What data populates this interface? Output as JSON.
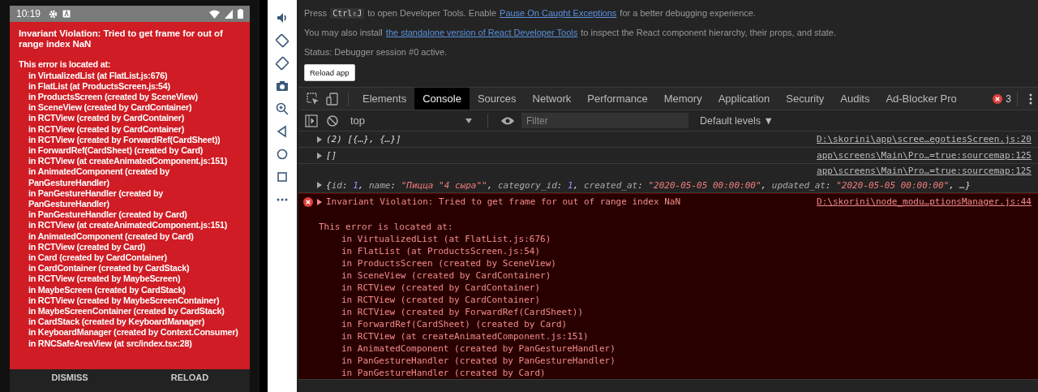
{
  "phone": {
    "status_bar": {
      "time": "10:19"
    },
    "error": {
      "title": "Invariant Violation: Tried to get frame for out of range index NaN",
      "lines": [
        {
          "kind": "header",
          "text": "This error is located at:"
        },
        {
          "kind": "frame",
          "text": "in VirtualizedList (at FlatList.js:676)"
        },
        {
          "kind": "frame",
          "text": "in FlatList (at ProductsScreen.js:54)"
        },
        {
          "kind": "frame",
          "text": "in ProductsScreen (created by SceneView)"
        },
        {
          "kind": "frame",
          "text": "in SceneView (created by CardContainer)"
        },
        {
          "kind": "frame",
          "text": "in RCTView (created by CardContainer)"
        },
        {
          "kind": "frame",
          "text": "in RCTView (created by CardContainer)"
        },
        {
          "kind": "frame",
          "text": "in RCTView (created by ForwardRef(CardSheet))"
        },
        {
          "kind": "frame",
          "text": "in ForwardRef(CardSheet) (created by Card)"
        },
        {
          "kind": "frame",
          "text": "in RCTView (at createAnimatedComponent.js:151)"
        },
        {
          "kind": "frame",
          "text": "in AnimatedComponent (created by PanGestureHandler)"
        },
        {
          "kind": "frame",
          "text": "in PanGestureHandler (created by PanGestureHandler)"
        },
        {
          "kind": "frame",
          "text": "in PanGestureHandler (created by Card)"
        },
        {
          "kind": "frame",
          "text": "in RCTView (at createAnimatedComponent.js:151)"
        },
        {
          "kind": "frame",
          "text": "in AnimatedComponent (created by Card)"
        },
        {
          "kind": "frame",
          "text": "in RCTView (created by Card)"
        },
        {
          "kind": "frame",
          "text": "in Card (created by CardContainer)"
        },
        {
          "kind": "frame",
          "text": "in CardContainer (created by CardStack)"
        },
        {
          "kind": "frame",
          "text": "in RCTView (created by MaybeScreen)"
        },
        {
          "kind": "frame",
          "text": "in MaybeScreen (created by CardStack)"
        },
        {
          "kind": "frame",
          "text": "in RCTView (created by MaybeScreenContainer)"
        },
        {
          "kind": "frame",
          "text": "in MaybeScreenContainer (created by CardStack)"
        },
        {
          "kind": "frame",
          "text": "in CardStack (created by KeyboardManager)"
        },
        {
          "kind": "frame",
          "text": "in KeyboardManager (created by Context.Consumer)"
        },
        {
          "kind": "frame",
          "text": "in RNCSafeAreaView (at src/index.tsx:28)"
        }
      ]
    },
    "buttons": [
      {
        "label": "DISMISS"
      },
      {
        "label": "RELOAD"
      }
    ]
  },
  "debugger": {
    "info": [
      [
        {
          "kind": "text",
          "text": "Press"
        },
        {
          "kind": "kbd",
          "text": "Ctrl⇧J"
        },
        {
          "kind": "text",
          "text": "to open Developer Tools. Enable"
        },
        {
          "kind": "link",
          "text": "Pause On Caught Exceptions"
        },
        {
          "kind": "text",
          "text": "for a better debugging experience."
        }
      ],
      [
        {
          "kind": "text",
          "text": "You may also install"
        },
        {
          "kind": "link",
          "text": "the standalone version of React Developer Tools"
        },
        {
          "kind": "text",
          "text": "to inspect the React component hierarchy, their props, and state."
        }
      ],
      [
        {
          "kind": "text",
          "text": "Status: Debugger session #0 active."
        }
      ]
    ],
    "reload_button": "Reload app"
  },
  "devtools": {
    "tabs": [
      {
        "label": "Elements",
        "selected": false
      },
      {
        "label": "Console",
        "selected": true
      },
      {
        "label": "Sources",
        "selected": false
      },
      {
        "label": "Network",
        "selected": false
      },
      {
        "label": "Performance",
        "selected": false
      },
      {
        "label": "Memory",
        "selected": false
      },
      {
        "label": "Application",
        "selected": false
      },
      {
        "label": "Security",
        "selected": false
      },
      {
        "label": "Audits",
        "selected": false
      },
      {
        "label": "Ad-Blocker Pro",
        "selected": false
      }
    ],
    "error_count": "3",
    "toolbar": {
      "context": "top",
      "filter_placeholder": "Filter",
      "levels": "Default levels ▼"
    },
    "console": [
      {
        "kind": "log",
        "source": "D:\\skorini\\app\\scree…egotiesScreen.js:20",
        "message": [
          {
            "kind": "plain",
            "text": "(2) [{…}, {…}]"
          }
        ]
      },
      {
        "kind": "log",
        "source": "app\\screens\\Main\\Pro…=true:sourcemap:125",
        "message": [
          {
            "kind": "plain",
            "text": "[]"
          }
        ]
      },
      {
        "kind": "object",
        "source": "app\\screens\\Main\\Pro…=true:sourcemap:125",
        "message": [
          {
            "kind": "plain",
            "text": "{"
          },
          {
            "kind": "key",
            "text": "id"
          },
          {
            "kind": "plain",
            "text": ": "
          },
          {
            "kind": "number",
            "text": "1"
          },
          {
            "kind": "plain",
            "text": ", "
          },
          {
            "kind": "key",
            "text": "name"
          },
          {
            "kind": "plain",
            "text": ": "
          },
          {
            "kind": "string",
            "text": "\"Пицца \"4 сыра\"\""
          },
          {
            "kind": "plain",
            "text": ", "
          },
          {
            "kind": "key",
            "text": "category_id"
          },
          {
            "kind": "plain",
            "text": ": "
          },
          {
            "kind": "number",
            "text": "1"
          },
          {
            "kind": "plain",
            "text": ", "
          },
          {
            "kind": "key",
            "text": "created_at"
          },
          {
            "kind": "plain",
            "text": ": "
          },
          {
            "kind": "string",
            "text": "\"2020-05-05 00:00:00\""
          },
          {
            "kind": "plain",
            "text": ", "
          },
          {
            "kind": "key",
            "text": "updated_at"
          },
          {
            "kind": "plain",
            "text": ": "
          },
          {
            "kind": "string",
            "text": "\"2020-05-05 00:00:00\""
          },
          {
            "kind": "plain",
            "text": ", …}"
          }
        ]
      },
      {
        "kind": "error",
        "source": "D:\\skorini\\node_modu…ptionsManager.js:44",
        "message": [
          {
            "kind": "plain",
            "text": "Invariant Violation: Tried to get frame for out of range index NaN"
          }
        ],
        "stack": [
          {
            "kind": "header",
            "text": "This error is located at:"
          },
          {
            "kind": "frame",
            "text": "in VirtualizedList (at FlatList.js:676)"
          },
          {
            "kind": "frame",
            "text": "in FlatList (at ProductsScreen.js:54)"
          },
          {
            "kind": "frame",
            "text": "in ProductsScreen (created by SceneView)"
          },
          {
            "kind": "frame",
            "text": "in SceneView (created by CardContainer)"
          },
          {
            "kind": "frame",
            "text": "in RCTView (created by CardContainer)"
          },
          {
            "kind": "frame",
            "text": "in RCTView (created by CardContainer)"
          },
          {
            "kind": "frame",
            "text": "in RCTView (created by ForwardRef(CardSheet))"
          },
          {
            "kind": "frame",
            "text": "in ForwardRef(CardSheet) (created by Card)"
          },
          {
            "kind": "frame",
            "text": "in RCTView (at createAnimatedComponent.js:151)"
          },
          {
            "kind": "frame",
            "text": "in AnimatedComponent (created by PanGestureHandler)"
          },
          {
            "kind": "frame",
            "text": "in PanGestureHandler (created by PanGestureHandler)"
          },
          {
            "kind": "frame",
            "text": "in PanGestureHandler (created by Card)"
          }
        ]
      }
    ]
  }
}
